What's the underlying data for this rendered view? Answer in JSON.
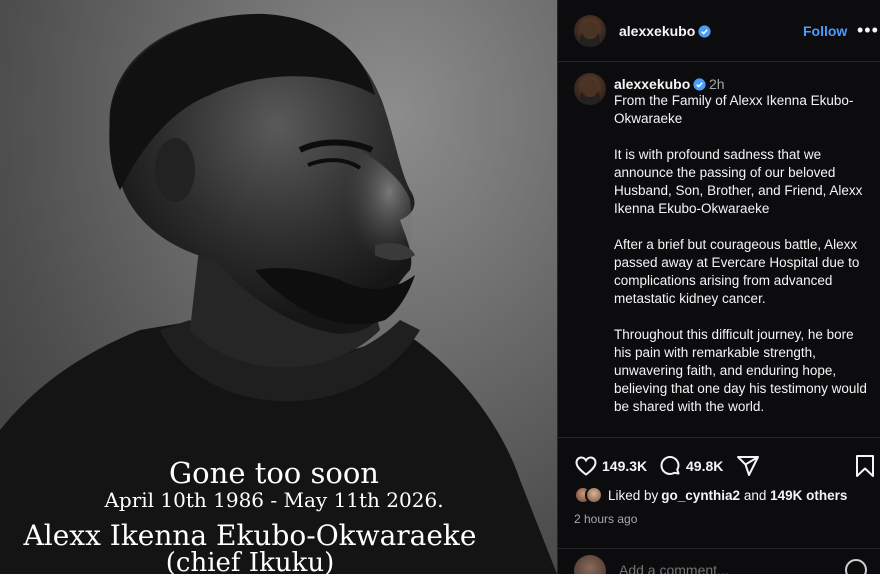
{
  "photo": {
    "caption_line1": "Gone too soon",
    "caption_line2": "April 10th 1986 - May 11th 2026.",
    "caption_line3": "Alexx Ikenna Ekubo-Okwaraeke",
    "caption_line4": "(chief Ikuku)"
  },
  "header": {
    "username": "alexxekubo",
    "follow_label": "Follow",
    "more_label": "•••"
  },
  "caption_comment": {
    "username": "alexxekubo",
    "time": "2h",
    "paragraphs": [
      "From the Family of Alexx Ikenna Ekubo-Okwaraeke",
      "It is with profound sadness that we announce the passing of our beloved Husband, Son, Brother, and Friend, Alexx Ikenna Ekubo-Okwaraeke",
      "After a brief but courageous battle, Alexx passed away at Evercare Hospital due to complications arising from advanced metastatic kidney cancer.",
      "Throughout this difficult journey, he bore his pain with remarkable strength, unwavering faith, and enduring hope, believing that one day his testimony would be shared with the world."
    ]
  },
  "actions": {
    "like_count": "149.3K",
    "comment_count": "49.8K",
    "liked_by_prefix": "Liked by ",
    "liked_by_user": "go_cynthia2",
    "liked_by_and": " and ",
    "liked_by_others": "149K others",
    "post_time": "2 hours ago"
  },
  "add_comment": {
    "placeholder": "Add a comment..."
  },
  "colors": {
    "accent": "#4a9df8",
    "panel_bg": "#0c0c0f",
    "divider": "#262626",
    "muted_text": "#a8a8a8"
  },
  "icons": [
    "verified-badge-icon",
    "heart-icon",
    "comment-icon",
    "share-icon",
    "bookmark-icon",
    "emoji-icon"
  ]
}
